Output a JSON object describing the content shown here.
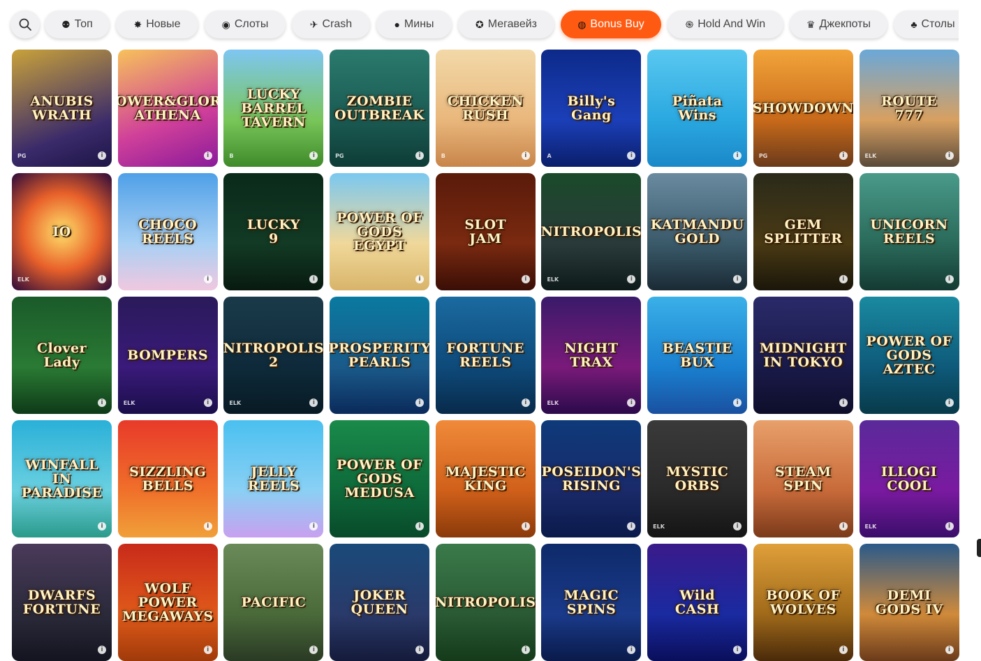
{
  "tabs": [
    {
      "label": "Топ",
      "icon": "top-icon",
      "glyph": "⚉",
      "w": 93
    },
    {
      "label": "Новые",
      "icon": "new-icon",
      "glyph": "✸",
      "w": 118
    },
    {
      "label": "Слоты",
      "icon": "slots-icon",
      "glyph": "◉",
      "w": 116
    },
    {
      "label": "Crash",
      "icon": "crash-icon",
      "glyph": "✈",
      "w": 112
    },
    {
      "label": "Мины",
      "icon": "mines-icon",
      "glyph": "●",
      "w": 108
    },
    {
      "label": "Мегавейз",
      "icon": "megaways-icon",
      "glyph": "✪",
      "w": 138
    },
    {
      "label": "Bonus Buy",
      "icon": "bonus-buy-icon",
      "glyph": "◍",
      "w": 144,
      "active": true
    },
    {
      "label": "Hold And Win",
      "icon": "hold-and-win-icon",
      "glyph": "֍",
      "w": 166
    },
    {
      "label": "Джекпоты",
      "icon": "jackpots-icon",
      "glyph": "♛",
      "w": 140
    },
    {
      "label": "Столы",
      "icon": "tables-icon",
      "glyph": "♣",
      "w": 112
    }
  ],
  "accent_color": "#ff5a12",
  "games": [
    {
      "title": "ANUBIS\nWRATH",
      "bg": "linear-gradient(160deg,#c9a23a,#3a2a6a 70%,#1d1546)",
      "prov": "PG"
    },
    {
      "title": "POWER&GLORY\nATHENA",
      "bg": "linear-gradient(160deg,#f7c25a,#d0409a 60%,#8a1a9a)",
      "prov": ""
    },
    {
      "title": "LUCKY\nBARREL\nTAVERN",
      "bg": "linear-gradient(180deg,#7ec6f2,#79c65a 60%,#3f8a2a)",
      "prov": "B"
    },
    {
      "title": "ZOMBIE\nOUTBREAK",
      "bg": "linear-gradient(180deg,#2b7a6e,#1a5a52 60%,#0e3c36)",
      "prov": "PG"
    },
    {
      "title": "CHICKEN\nRUSH",
      "bg": "linear-gradient(180deg,#f2d9a8,#e9b77c 60%,#c8854a)",
      "prov": "B"
    },
    {
      "title": "Billy's\nGang",
      "bg": "linear-gradient(180deg,#0d2a8a,#1b3fb8 60%,#0a1e6a)",
      "prov": "A"
    },
    {
      "title": "Piñata\nWins",
      "bg": "linear-gradient(180deg,#59c8f0,#2aa8e0 60%,#1a88c8)",
      "prov": ""
    },
    {
      "title": "SHOWDOWN",
      "bg": "linear-gradient(180deg,#f2a43a,#c86a1a 60%,#6a3a1a)",
      "prov": "PG"
    },
    {
      "title": "ROUTE\n777",
      "bg": "linear-gradient(180deg,#6aa8d8,#d8a060 60%,#5a4a3a)",
      "prov": "ELK"
    },
    {
      "title": "IO",
      "bg": "radial-gradient(circle,#ffe06a,#e8602a 50%,#2a0a3a)",
      "prov": "ELK"
    },
    {
      "title": "CHOCO\nREELS",
      "bg": "linear-gradient(180deg,#4fa0e8,#a8d0f4 60%,#f0c8e0)",
      "prov": ""
    },
    {
      "title": "LUCKY\n9",
      "bg": "linear-gradient(180deg,#0a2a1a,#123a24 60%,#081a10)",
      "prov": ""
    },
    {
      "title": "POWER OF GODS\nEGYPT",
      "bg": "linear-gradient(180deg,#7ac8f0,#f0d89a 60%,#d8b46a)",
      "prov": ""
    },
    {
      "title": "SLOT\nJAM",
      "bg": "linear-gradient(180deg,#5a1a0a,#7a2a10 60%,#3a0e06)",
      "prov": ""
    },
    {
      "title": "NITROPOLIS",
      "bg": "linear-gradient(180deg,#1a4a2a,#2a3a3a 60%,#0e1a1a)",
      "prov": "ELK"
    },
    {
      "title": "KATMANDU\nGOLD",
      "bg": "linear-gradient(180deg,#6a8aa0,#3a5a6a 60%,#1a2a34)",
      "prov": ""
    },
    {
      "title": "GEM\nSPLITTER",
      "bg": "linear-gradient(180deg,#2a2a1a,#4a3a14 60%,#1a160a)",
      "prov": ""
    },
    {
      "title": "UNICORN\nREELS",
      "bg": "linear-gradient(180deg,#4a9a8a,#2a6a5a 60%,#143a32)",
      "prov": ""
    },
    {
      "title": "Clover\nLady",
      "bg": "linear-gradient(180deg,#1a5a2a,#2a7a34 60%,#0e3a18)",
      "prov": ""
    },
    {
      "title": "BOMPERS",
      "bg": "linear-gradient(180deg,#2a1a5a,#3a1a7a 60%,#1a0e4a)",
      "prov": "ELK"
    },
    {
      "title": "NITROPOLIS 2",
      "bg": "linear-gradient(180deg,#1a3a4a,#0e2a3a 60%,#081a24)",
      "prov": "ELK"
    },
    {
      "title": "PROSPERITY\nPEARLS",
      "bg": "linear-gradient(180deg,#0a7aa0,#1a5a8a 60%,#0a2a5a)",
      "prov": ""
    },
    {
      "title": "FORTUNE\nREELS",
      "bg": "linear-gradient(180deg,#1a6aa0,#0e4a7a 60%,#082a4a)",
      "prov": ""
    },
    {
      "title": "NIGHT\nTRAX",
      "bg": "linear-gradient(180deg,#3a1a6a,#7a1a7a 60%,#2a0a4a)",
      "prov": "ELK"
    },
    {
      "title": "BEASTIE\nBUX",
      "bg": "linear-gradient(180deg,#3ab0e8,#1a80d0 60%,#1a50a0)",
      "prov": ""
    },
    {
      "title": "MIDNIGHT\nIN TOKYO",
      "bg": "linear-gradient(180deg,#2a2a6a,#1a1a4a 60%,#0e0e2a)",
      "prov": ""
    },
    {
      "title": "POWER OF GODS\nAZTEC",
      "bg": "linear-gradient(180deg,#1a8aa0,#0e5a7a 60%,#083a4a)",
      "prov": ""
    },
    {
      "title": "WINFALL\nIN\nPARADISE",
      "bg": "linear-gradient(180deg,#2ab0d8,#6ad0e0 60%,#2a9a8a)",
      "prov": ""
    },
    {
      "title": "SIZZLING\nBELLS",
      "bg": "linear-gradient(180deg,#e83a2a,#f0702a 60%,#f0a03a)",
      "prov": ""
    },
    {
      "title": "JELLY\nREELS",
      "bg": "linear-gradient(180deg,#4ac0f0,#8ad0f4 60%,#c8a0f0)",
      "prov": ""
    },
    {
      "title": "POWER OF GODS\nMEDUSA",
      "bg": "linear-gradient(180deg,#1a8a4a,#0e6a3a 60%,#084a2a)",
      "prov": ""
    },
    {
      "title": "MAJESTIC\nKING",
      "bg": "linear-gradient(180deg,#f08a3a,#d0601a 60%,#8a3a0a)",
      "prov": ""
    },
    {
      "title": "POSEIDON'S\nRISING",
      "bg": "linear-gradient(180deg,#0e3a7a,#1a2a6a 60%,#0a1a4a)",
      "prov": ""
    },
    {
      "title": "MYSTIC\nORBS",
      "bg": "linear-gradient(180deg,#3a3a3a,#2a2a2a 60%,#141414)",
      "prov": "ELK"
    },
    {
      "title": "STEAM\nSPIN",
      "bg": "linear-gradient(180deg,#e8a06a,#c86a3a 60%,#7a3a1a)",
      "prov": ""
    },
    {
      "title": "ILLOGI\nCOOL",
      "bg": "linear-gradient(180deg,#5a2a9a,#7a1aa0 60%,#3a0e6a)",
      "prov": "ELK"
    },
    {
      "title": "DWARFS\nFORTUNE",
      "bg": "linear-gradient(180deg,#4a3a5a,#2a2a3a 60%,#141420)",
      "prov": ""
    },
    {
      "title": "WOLF\nPOWER\nMEGAWAYS",
      "bg": "linear-gradient(180deg,#c82a1a,#e05a1a 60%,#a03a0a)",
      "prov": ""
    },
    {
      "title": "PACIFIC",
      "bg": "linear-gradient(180deg,#6a8a5a,#4a6a3a 60%,#2a3a24)",
      "prov": ""
    },
    {
      "title": "JOKER\nQUEEN",
      "bg": "linear-gradient(180deg,#1a4a7a,#2a3a6a 60%,#141a3a)",
      "prov": ""
    },
    {
      "title": "NITROPOLIS",
      "bg": "linear-gradient(180deg,#3a7a4a,#2a5a34 60%,#143a1a)",
      "prov": ""
    },
    {
      "title": "MAGIC\nSPINS",
      "bg": "linear-gradient(180deg,#0e2a6a,#1a3a8a 60%,#0a1a4a)",
      "prov": ""
    },
    {
      "title": "Wild\nCASH",
      "bg": "linear-gradient(180deg,#3a1a8a,#1a2aa0 60%,#0a0e5a)",
      "prov": ""
    },
    {
      "title": "BOOK OF\nWOLVES",
      "bg": "linear-gradient(180deg,#e0a03a,#a06a1a 60%,#4a2a0a)",
      "prov": ""
    },
    {
      "title": "DEMI GODS IV",
      "bg": "linear-gradient(180deg,#2a5a8a,#d08a3a 60%,#6a3a1a)",
      "prov": ""
    }
  ]
}
